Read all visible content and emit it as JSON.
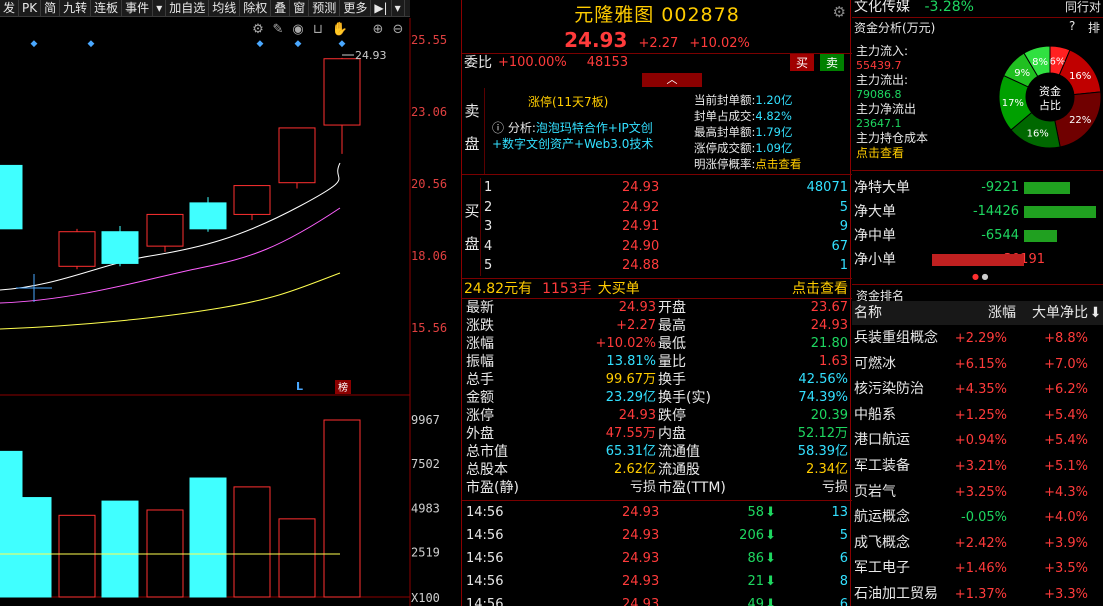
{
  "toolbar": {
    "items": [
      "发",
      "PK",
      "简",
      "九转",
      "连板",
      "事件",
      "▾",
      "加自选",
      "均线",
      "除权",
      "叠",
      "窗",
      "预测",
      "更多",
      "▶|",
      "▾"
    ]
  },
  "chart": {
    "y_ticks": [
      "25.55",
      "23.06",
      "20.56",
      "18.06",
      "15.56"
    ],
    "top_price_label": "24.93",
    "vol_ticks": [
      "9967",
      "7502",
      "4983",
      "2519",
      "X100"
    ],
    "l_marker": "L",
    "bang_marker": "榜",
    "candles": [
      {
        "o": 19.0,
        "c": 21.2,
        "h": 21.2,
        "l": 19.0,
        "up": false
      },
      {
        "o": 17.7,
        "c": 18.9,
        "h": 19.0,
        "l": 17.6,
        "up": true
      },
      {
        "o": 17.8,
        "c": 18.9,
        "h": 19.1,
        "l": 17.7,
        "up": false
      },
      {
        "o": 18.4,
        "c": 19.5,
        "h": 19.5,
        "l": 18.2,
        "up": true
      },
      {
        "o": 19.0,
        "c": 19.9,
        "h": 20.1,
        "l": 18.9,
        "up": false
      },
      {
        "o": 19.5,
        "c": 20.5,
        "h": 20.5,
        "l": 19.3,
        "up": true
      },
      {
        "o": 20.6,
        "c": 22.5,
        "h": 22.5,
        "l": 20.4,
        "up": true
      },
      {
        "o": 22.6,
        "c": 24.9,
        "h": 24.93,
        "l": 21.6,
        "up": true
      }
    ],
    "volumes": [
      8200,
      5600,
      4600,
      5400,
      4900,
      6700,
      6200,
      4400,
      9967
    ],
    "indicator_colors": {
      "up": "#ff3030",
      "down": "#40ffff",
      "ma5": "#ffffff",
      "ma10": "#ff60ff",
      "ma20": "#ffff50"
    }
  },
  "stock": {
    "name": "元隆雅图",
    "code": "002878",
    "price": "24.93",
    "change": "+2.27",
    "change_pct": "+10.02%",
    "weibi_label": "委比",
    "weibi_value": "+100.00%",
    "weicha_value": "48153",
    "buy_btn": "买",
    "sell_btn": "卖",
    "limit_up_text": "涨停(11天7板)",
    "analysis_label": "分析:",
    "analysis_text1": "泡泡玛特合作+IP文创",
    "analysis_text2": "+数字文创资产+Web3.0技术",
    "seal_stats": [
      {
        "label": "当前封单额:",
        "value": "1.20亿"
      },
      {
        "label": "封单占成交:",
        "value": "4.82%"
      },
      {
        "label": "最高封单额:",
        "value": "1.79亿"
      },
      {
        "label": "涨停成交额:",
        "value": "1.09亿"
      },
      {
        "label": "明涨停概率:",
        "value": "点击查看"
      }
    ],
    "sell_side_label_1": "卖",
    "sell_side_label_2": "盘",
    "buy_side_label_1": "买",
    "buy_side_label_2": "盘",
    "bids": [
      {
        "level": "1",
        "price": "24.93",
        "vol": "48071"
      },
      {
        "level": "2",
        "price": "24.92",
        "vol": "5"
      },
      {
        "level": "3",
        "price": "24.91",
        "vol": "9"
      },
      {
        "level": "4",
        "price": "24.90",
        "vol": "67"
      },
      {
        "level": "5",
        "price": "24.88",
        "vol": "1"
      }
    ],
    "big_buy_price": "24.82",
    "big_buy_mid": "元有",
    "big_buy_hands": "1153手",
    "big_buy_text": "大买单",
    "big_buy_link": "点击查看",
    "stats_left": [
      {
        "label": "最新",
        "value": "24.93",
        "cls": "red"
      },
      {
        "label": "涨跌",
        "value": "+2.27",
        "cls": "red"
      },
      {
        "label": "涨幅",
        "value": "+10.02%",
        "cls": "red"
      },
      {
        "label": "振幅",
        "value": "13.81%",
        "cls": "cyan"
      },
      {
        "label": "总手",
        "value": "99.67万",
        "cls": "yellow"
      },
      {
        "label": "金额",
        "value": "23.29亿",
        "cls": "cyan"
      },
      {
        "label": "涨停",
        "value": "24.93",
        "cls": "red"
      },
      {
        "label": "外盘",
        "value": "47.55万",
        "cls": "red"
      },
      {
        "label": "总市值",
        "value": "65.31亿",
        "cls": "cyan"
      },
      {
        "label": "总股本",
        "value": "2.62亿",
        "cls": "yellow"
      },
      {
        "label": "市盈(静)",
        "value": "亏损",
        "cls": "white"
      }
    ],
    "stats_right": [
      {
        "label": "开盘",
        "value": "23.67",
        "cls": "red"
      },
      {
        "label": "最高",
        "value": "24.93",
        "cls": "red"
      },
      {
        "label": "最低",
        "value": "21.80",
        "cls": "green"
      },
      {
        "label": "量比",
        "value": "1.63",
        "cls": "red"
      },
      {
        "label": "换手",
        "value": "42.56%",
        "cls": "cyan"
      },
      {
        "label": "换手(实)",
        "value": "74.39%",
        "cls": "cyan"
      },
      {
        "label": "跌停",
        "value": "20.39",
        "cls": "green"
      },
      {
        "label": "内盘",
        "value": "52.12万",
        "cls": "green"
      },
      {
        "label": "流通值",
        "value": "58.39亿",
        "cls": "cyan"
      },
      {
        "label": "流通股",
        "value": "2.34亿",
        "cls": "yellow"
      },
      {
        "label": "市盈(TTM)",
        "value": "亏损",
        "cls": "white"
      }
    ],
    "ticks": [
      {
        "time": "14:56",
        "price": "24.93",
        "vol": "58",
        "num": "13"
      },
      {
        "time": "14:56",
        "price": "24.93",
        "vol": "206",
        "num": "5"
      },
      {
        "time": "14:56",
        "price": "24.93",
        "vol": "86",
        "num": "6"
      },
      {
        "time": "14:56",
        "price": "24.93",
        "vol": "21",
        "num": "8"
      },
      {
        "time": "14:56",
        "price": "24.93",
        "vol": "49",
        "num": "6"
      }
    ]
  },
  "right": {
    "sector_name": "文化传媒",
    "sector_change": "-3.28%",
    "sector_link": "同行对",
    "fund_title": "资金分析(万元)",
    "question": "?",
    "paihang_btn": "排",
    "main_inflow_label": "主力流入:",
    "main_inflow_value": "55439.7",
    "main_outflow_label": "主力流出:",
    "main_outflow_value": "79086.8",
    "main_net_label": "主力净流出",
    "main_net_value": "23647.1",
    "main_cost_label": "主力持仓成本",
    "main_cost_link": "点击查看",
    "donut_center_1": "资金",
    "donut_center_2": "占比",
    "donut_slices": [
      {
        "label": "6%",
        "value": 6,
        "color": "#ff2020"
      },
      {
        "label": "16%",
        "value": 16,
        "color": "#c00000"
      },
      {
        "label": "22%",
        "value": 22,
        "color": "#700000"
      },
      {
        "label": "16%",
        "value": 16,
        "color": "#006800"
      },
      {
        "label": "17%",
        "value": 17,
        "color": "#00a000"
      },
      {
        "label": "9%",
        "value": 9,
        "color": "#20c020"
      },
      {
        "label": "8%",
        "value": 8,
        "color": "#30e040"
      }
    ],
    "flows": [
      {
        "label": "净特大单",
        "value": "-9221",
        "amount": 9221,
        "positive": false
      },
      {
        "label": "净大单",
        "value": "-14426",
        "amount": 14426,
        "positive": false
      },
      {
        "label": "净中单",
        "value": "-6544",
        "amount": 6544,
        "positive": false
      },
      {
        "label": "净小单",
        "value": "30191",
        "amount": 30191,
        "positive": true
      }
    ],
    "rank_title": "资金排名",
    "rank_headers": {
      "name": "名称",
      "change": "涨幅",
      "net": "大单净比"
    },
    "rank_rows": [
      {
        "name": "兵装重组概念",
        "change": "+2.29%",
        "net": "+8.8%"
      },
      {
        "name": "可燃冰",
        "change": "+6.15%",
        "net": "+7.0%"
      },
      {
        "name": "核污染防治",
        "change": "+4.35%",
        "net": "+6.2%"
      },
      {
        "name": "中船系",
        "change": "+1.25%",
        "net": "+5.4%"
      },
      {
        "name": "港口航运",
        "change": "+0.94%",
        "net": "+5.4%"
      },
      {
        "name": "军工装备",
        "change": "+3.21%",
        "net": "+5.1%"
      },
      {
        "name": "页岩气",
        "change": "+3.25%",
        "net": "+4.3%"
      },
      {
        "name": "航运概念",
        "change": "-0.05%",
        "net": "+4.0%"
      },
      {
        "name": "成飞概念",
        "change": "+2.42%",
        "net": "+3.9%"
      },
      {
        "name": "军工电子",
        "change": "+1.46%",
        "net": "+3.5%"
      },
      {
        "name": "石油加工贸易",
        "change": "+1.37%",
        "net": "+3.3%"
      }
    ]
  }
}
